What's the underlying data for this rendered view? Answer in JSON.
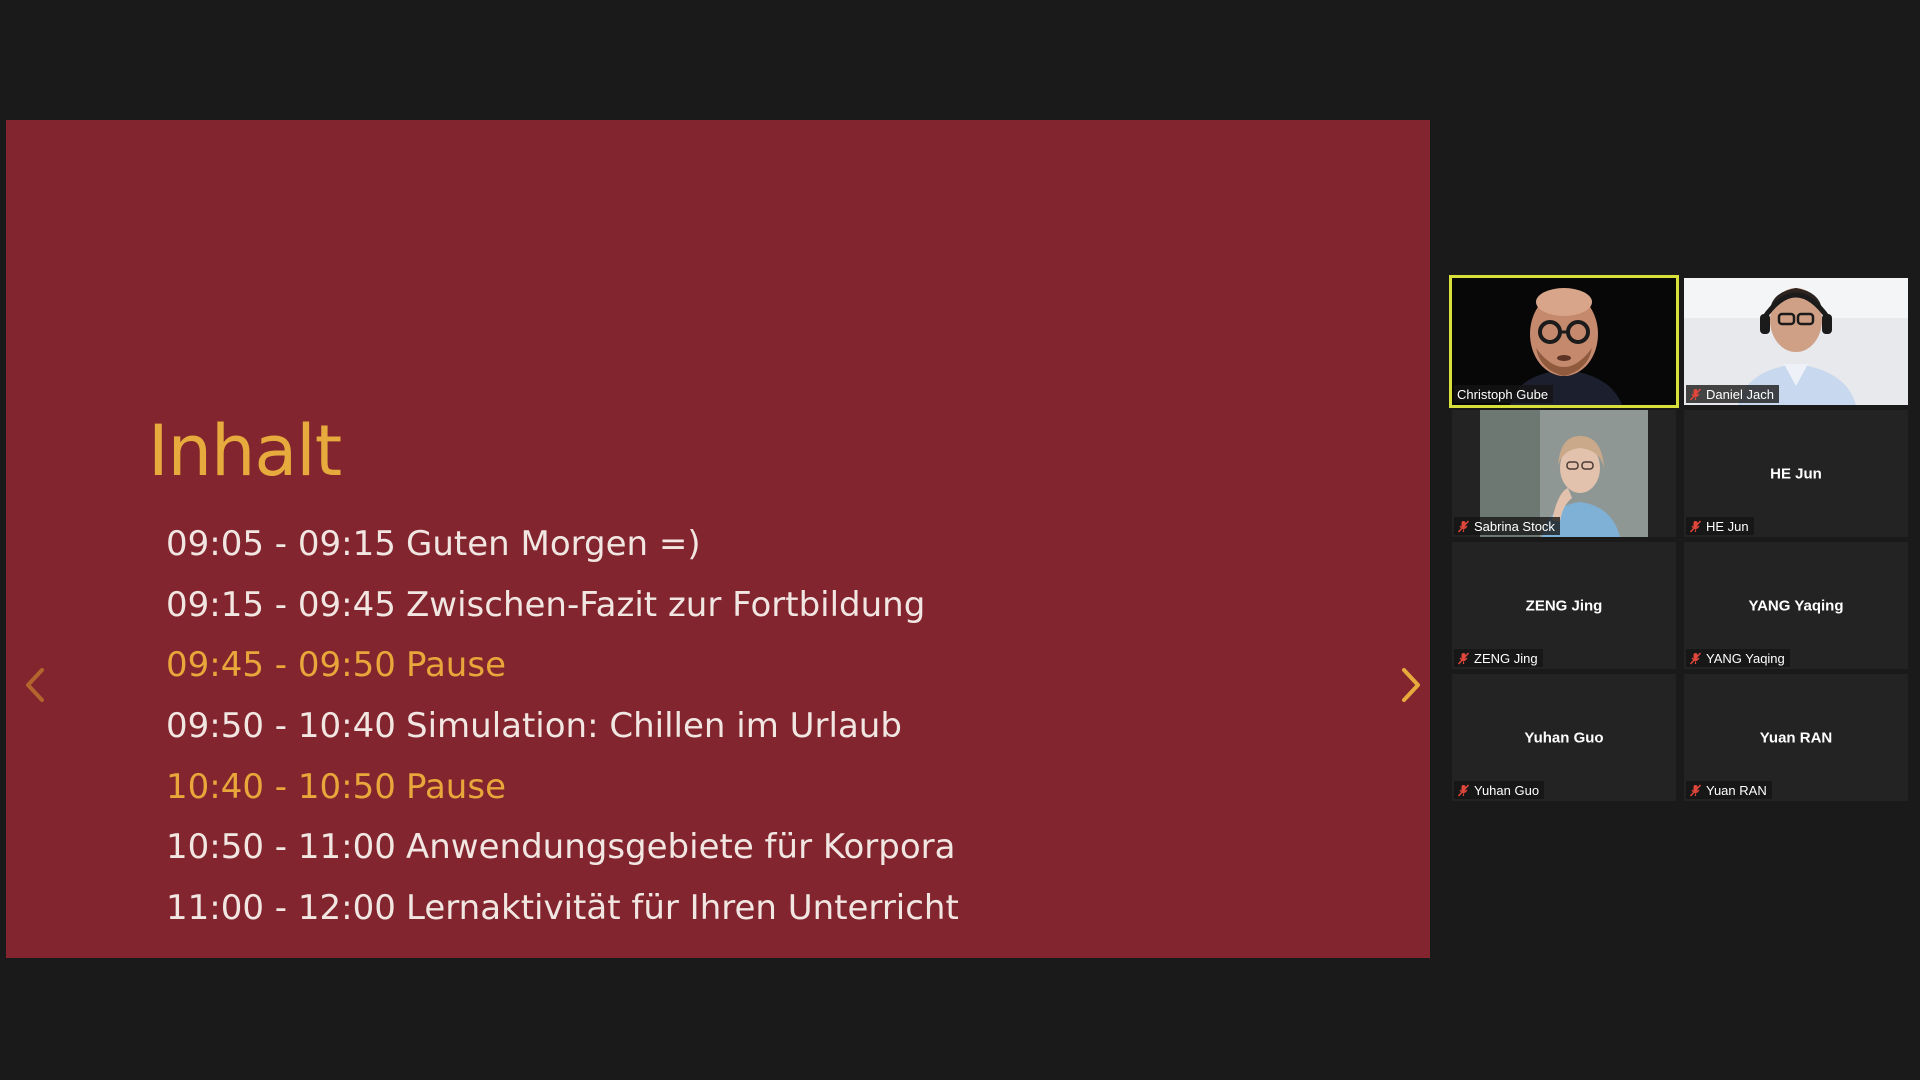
{
  "slide": {
    "title": "Inhalt",
    "agenda": [
      {
        "time": "09:05 - 09:15",
        "topic": "Guten Morgen =)",
        "highlight": false
      },
      {
        "time": "09:15 - 09:45",
        "topic": "Zwischen-Fazit zur Fortbildung",
        "highlight": false
      },
      {
        "time": "09:45 - 09:50",
        "topic": "Pause",
        "highlight": true
      },
      {
        "time": "09:50 - 10:40",
        "topic": "Simulation: Chillen im Urlaub",
        "highlight": false
      },
      {
        "time": "10:40 - 10:50",
        "topic": "Pause",
        "highlight": true
      },
      {
        "time": "10:50 - 11:00",
        "topic": "Anwendungsgebiete für Korpora",
        "highlight": false
      },
      {
        "time": "11:00 - 12:00",
        "topic": "Lernaktivität für Ihren Unterricht",
        "highlight": false
      }
    ],
    "prev_icon": "chevron-left-icon",
    "next_icon": "chevron-right-icon"
  },
  "participants": [
    {
      "name": "Christoph Gube",
      "video": true,
      "muted": false,
      "speaking": true
    },
    {
      "name": "Daniel Jach",
      "video": true,
      "muted": true,
      "speaking": false
    },
    {
      "name": "Sabrina Stock",
      "video": true,
      "muted": true,
      "speaking": false
    },
    {
      "name": "HE Jun",
      "video": false,
      "muted": true,
      "speaking": false
    },
    {
      "name": "ZENG Jing",
      "video": false,
      "muted": true,
      "speaking": false
    },
    {
      "name": "YANG Yaqing",
      "video": false,
      "muted": true,
      "speaking": false
    },
    {
      "name": "Yuhan Guo",
      "video": false,
      "muted": true,
      "speaking": false
    },
    {
      "name": "Yuan RAN",
      "video": false,
      "muted": true,
      "speaking": false
    }
  ],
  "colors": {
    "background": "#1a1a1a",
    "slide_bg": "#82252e",
    "accent": "#e7aa3c",
    "slide_text": "#f1e6e2",
    "speaker_border": "#d9df3a",
    "mute": "#e0463a"
  }
}
